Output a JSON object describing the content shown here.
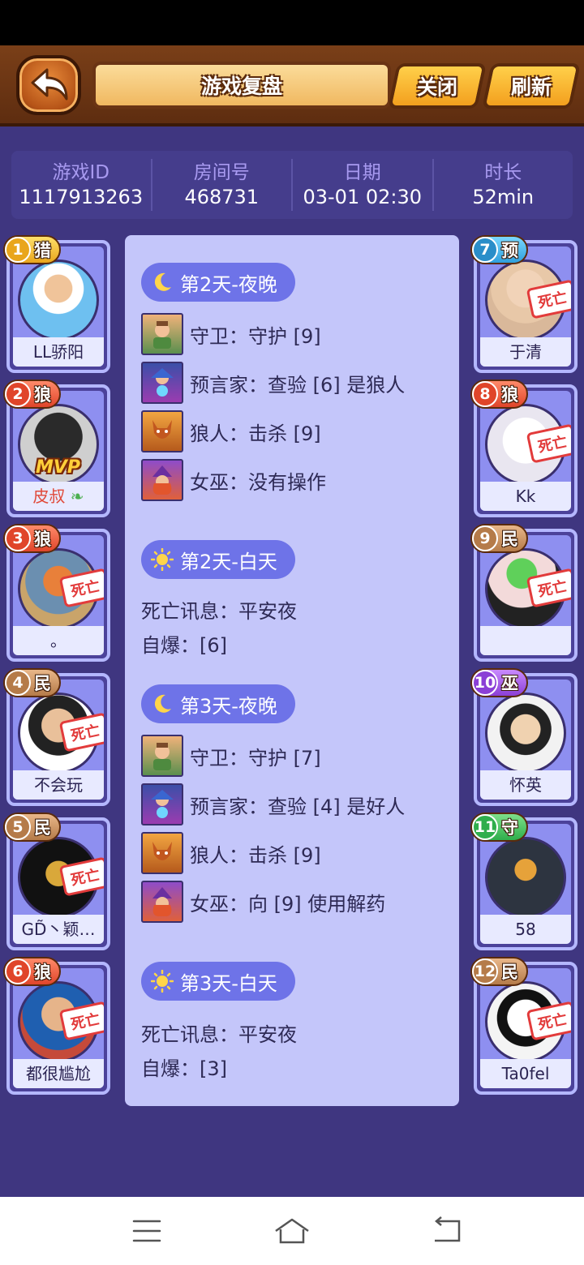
{
  "header": {
    "title": "游戏复盘",
    "close_label": "关闭",
    "refresh_label": "刷新"
  },
  "info": {
    "game_id_label": "游戏ID",
    "game_id": "1117913263",
    "room_label": "房间号",
    "room": "468731",
    "date_label": "日期",
    "date": "03-01 02:30",
    "duration_label": "时长",
    "duration": "52min"
  },
  "dead_stamp_text": "死亡",
  "mvp_text": "MVP",
  "players_left": [
    {
      "num": "1",
      "role": "猎",
      "name": "LL骄阳",
      "dead": false,
      "color": "#ffd54a"
    },
    {
      "num": "2",
      "role": "狼",
      "name": "皮叔",
      "dead": false,
      "mvp": true,
      "color": "#e0452a"
    },
    {
      "num": "3",
      "role": "狼",
      "name": "。",
      "dead": true,
      "color": "#e0452a"
    },
    {
      "num": "4",
      "role": "民",
      "name": "不会玩",
      "dead": true,
      "color": "#b57b49"
    },
    {
      "num": "5",
      "role": "民",
      "name": "GD̃丶颖…",
      "dead": true,
      "color": "#b57b49"
    },
    {
      "num": "6",
      "role": "狼",
      "name": "都很尴尬",
      "dead": true,
      "color": "#e0452a"
    }
  ],
  "players_right": [
    {
      "num": "7",
      "role": "预",
      "name": "于清",
      "dead": true,
      "color": "#2a8ec9"
    },
    {
      "num": "8",
      "role": "狼",
      "name": "Kk",
      "dead": true,
      "color": "#e0452a"
    },
    {
      "num": "9",
      "role": "民",
      "name": "",
      "dead": true,
      "color": "#b57b49"
    },
    {
      "num": "10",
      "role": "巫",
      "name": "怀英",
      "dead": false,
      "color": "#8b3fd6"
    },
    {
      "num": "11",
      "role": "守",
      "name": "58",
      "dead": false,
      "color": "#2fae4c"
    },
    {
      "num": "12",
      "role": "民",
      "name": "Ta0fel",
      "dead": true,
      "color": "#b57b49"
    }
  ],
  "log": {
    "day2_night": {
      "title": "第2天-夜晚",
      "lines": [
        {
          "icon": "guard-icon",
          "text": "守卫：守护 [9]"
        },
        {
          "icon": "seer-icon",
          "text": "预言家：查验 [6] 是狼人"
        },
        {
          "icon": "werewolf-icon",
          "text": "狼人：击杀 [9]"
        },
        {
          "icon": "witch-icon",
          "text": "女巫：没有操作"
        }
      ]
    },
    "day2_day": {
      "title": "第2天-白天",
      "death": "死亡讯息：平安夜",
      "explode": "自爆：[6]"
    },
    "day3_night": {
      "title": "第3天-夜晚",
      "lines": [
        {
          "icon": "guard-icon",
          "text": "守卫：守护 [7]"
        },
        {
          "icon": "seer-icon",
          "text": "预言家：查验 [4] 是好人"
        },
        {
          "icon": "werewolf-icon",
          "text": "狼人：击杀 [9]"
        },
        {
          "icon": "witch-icon",
          "text": "女巫：向 [9] 使用解药"
        }
      ]
    },
    "day3_day": {
      "title": "第3天-白天",
      "death": "死亡讯息：平安夜",
      "explode": "自爆：[3]"
    }
  }
}
